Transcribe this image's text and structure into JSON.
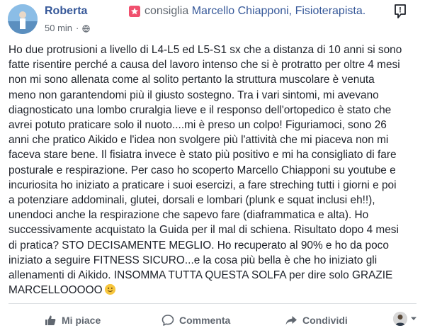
{
  "post": {
    "author": "Roberta",
    "recommends_label": "consiglia",
    "page_name": "Marcello Chiapponi, Fisioterapista.",
    "time": "50 min",
    "separator": "·",
    "more_label": "!",
    "body": "Ho due protrusioni a livello di L4-L5 ed L5-S1 sx che a distanza di 10 anni si sono\nfatte risentire perché a causa del lavoro intenso che si è protratto per oltre 4 mesi\nnon mi sono allenata come al solito pertanto la struttura muscolare è venuta\nmeno non garantendomi più il giusto sostegno. Tra i vari sintomi, mi avevano\ndiagnosticato una lombo cruralgia lieve e il responso dell'ortopedico è stato che\navrei potuto praticare solo il nuoto....mi è preso un colpo! Figuriamoci, sono 26\nanni che pratico Aikido e l'idea non svolgere più l'attività che mi piaceva non mi\nfaceva stare bene. Il fisiatra invece è stato più positivo e mi ha consigliato di fare\nposturale e respirazione. Per caso ho scoperto Marcello Chiapponi su youtube e\nincuriosita ho iniziato a praticare i suoi esercizi, a fare streching tutti i giorni e poi\na potenziare addominali, glutei, dorsali e lombari (plunk e squat inclusi eh!!),\nunendoci anche la respirazione che sapevo fare (diaframmatica e alta). Ho\nsuccessivamente acquistato la Guida per il mal di schiena. Risultato dopo 4 mesi\ndi pratica? STO DECISAMENTE MEGLIO. Ho recuperato al 90% e ho da poco\niniziato a seguire FITNESS SICURO...e la cosa più bella è che ho iniziato gli\nallenamenti di Aikido. INSOMMA TUTTA QUESTA SOLFA per dire solo GRAZIE\nMARCELLOOOOO"
  },
  "actions": {
    "like": "Mi piace",
    "comment": "Commenta",
    "share": "Condividi"
  },
  "icons": {
    "recommend": "recommend-star-icon",
    "privacy": "globe-icon",
    "emoji": "smiley-emoji-icon",
    "like": "thumbs-up-icon",
    "comment": "comment-bubble-icon",
    "share": "share-arrow-icon",
    "audience": "chevron-down-icon"
  },
  "colors": {
    "link": "#365899",
    "text": "#1d2129",
    "muted": "#606770",
    "recommend": "#f0506e"
  }
}
